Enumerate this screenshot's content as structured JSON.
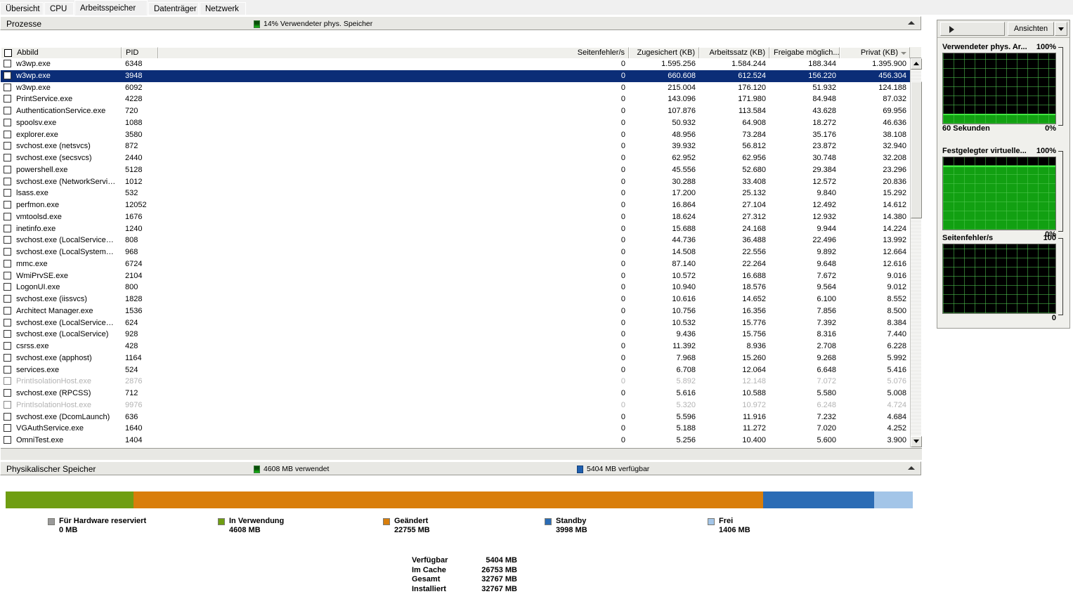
{
  "tabs": [
    {
      "label": "Übersicht",
      "selected": false
    },
    {
      "label": "CPU",
      "selected": false
    },
    {
      "label": "Arbeitsspeicher",
      "selected": true
    },
    {
      "label": "Datenträger",
      "selected": false
    },
    {
      "label": "Netzwerk",
      "selected": false
    }
  ],
  "processes_section": {
    "title": "Prozesse",
    "meter_label": "14% Verwendeter phys. Speicher",
    "meter_swatch_color": "#19c219",
    "collapse_icon": "triangle-up-icon"
  },
  "table": {
    "columns": [
      {
        "key": "image",
        "label": "Abbild",
        "align": "left"
      },
      {
        "key": "pid",
        "label": "PID",
        "align": "left"
      },
      {
        "key": "faults",
        "label": "Seitenfehler/s",
        "align": "right"
      },
      {
        "key": "commit",
        "label": "Zugesichert (KB)",
        "align": "right"
      },
      {
        "key": "working",
        "label": "Arbeitssatz (KB)",
        "align": "right"
      },
      {
        "key": "shareable",
        "label": "Freigabe möglich...",
        "align": "right"
      },
      {
        "key": "private",
        "label": "Privat (KB)",
        "align": "right",
        "sorted": true
      }
    ],
    "rows": [
      {
        "image": "w3wp.exe",
        "pid": "6348",
        "faults": "0",
        "commit": "1.595.256",
        "working": "1.584.244",
        "shareable": "188.344",
        "private": "1.395.900",
        "selected": false,
        "dim": false
      },
      {
        "image": "w3wp.exe",
        "pid": "3948",
        "faults": "0",
        "commit": "660.608",
        "working": "612.524",
        "shareable": "156.220",
        "private": "456.304",
        "selected": true,
        "dim": false
      },
      {
        "image": "w3wp.exe",
        "pid": "6092",
        "faults": "0",
        "commit": "215.004",
        "working": "176.120",
        "shareable": "51.932",
        "private": "124.188",
        "selected": false,
        "dim": false
      },
      {
        "image": "PrintService.exe",
        "pid": "4228",
        "faults": "0",
        "commit": "143.096",
        "working": "171.980",
        "shareable": "84.948",
        "private": "87.032",
        "selected": false,
        "dim": false
      },
      {
        "image": "AuthenticationService.exe",
        "pid": "720",
        "faults": "0",
        "commit": "107.876",
        "working": "113.584",
        "shareable": "43.628",
        "private": "69.956",
        "selected": false,
        "dim": false
      },
      {
        "image": "spoolsv.exe",
        "pid": "1088",
        "faults": "0",
        "commit": "50.932",
        "working": "64.908",
        "shareable": "18.272",
        "private": "46.636",
        "selected": false,
        "dim": false
      },
      {
        "image": "explorer.exe",
        "pid": "3580",
        "faults": "0",
        "commit": "48.956",
        "working": "73.284",
        "shareable": "35.176",
        "private": "38.108",
        "selected": false,
        "dim": false
      },
      {
        "image": "svchost.exe (netsvcs)",
        "pid": "872",
        "faults": "0",
        "commit": "39.932",
        "working": "56.812",
        "shareable": "23.872",
        "private": "32.940",
        "selected": false,
        "dim": false
      },
      {
        "image": "svchost.exe (secsvcs)",
        "pid": "2440",
        "faults": "0",
        "commit": "62.952",
        "working": "62.956",
        "shareable": "30.748",
        "private": "32.208",
        "selected": false,
        "dim": false
      },
      {
        "image": "powershell.exe",
        "pid": "5128",
        "faults": "0",
        "commit": "45.556",
        "working": "52.680",
        "shareable": "29.384",
        "private": "23.296",
        "selected": false,
        "dim": false
      },
      {
        "image": "svchost.exe (NetworkService)",
        "pid": "1012",
        "faults": "0",
        "commit": "30.288",
        "working": "33.408",
        "shareable": "12.572",
        "private": "20.836",
        "selected": false,
        "dim": false
      },
      {
        "image": "lsass.exe",
        "pid": "532",
        "faults": "0",
        "commit": "17.200",
        "working": "25.132",
        "shareable": "9.840",
        "private": "15.292",
        "selected": false,
        "dim": false
      },
      {
        "image": "perfmon.exe",
        "pid": "12052",
        "faults": "0",
        "commit": "16.864",
        "working": "27.104",
        "shareable": "12.492",
        "private": "14.612",
        "selected": false,
        "dim": false
      },
      {
        "image": "vmtoolsd.exe",
        "pid": "1676",
        "faults": "0",
        "commit": "18.624",
        "working": "27.312",
        "shareable": "12.932",
        "private": "14.380",
        "selected": false,
        "dim": false
      },
      {
        "image": "inetinfo.exe",
        "pid": "1240",
        "faults": "0",
        "commit": "15.688",
        "working": "24.168",
        "shareable": "9.944",
        "private": "14.224",
        "selected": false,
        "dim": false
      },
      {
        "image": "svchost.exe (LocalServiceNetwo...",
        "pid": "808",
        "faults": "0",
        "commit": "44.736",
        "working": "36.488",
        "shareable": "22.496",
        "private": "13.992",
        "selected": false,
        "dim": false
      },
      {
        "image": "svchost.exe (LocalSystemNetwo...",
        "pid": "968",
        "faults": "0",
        "commit": "14.508",
        "working": "22.556",
        "shareable": "9.892",
        "private": "12.664",
        "selected": false,
        "dim": false
      },
      {
        "image": "mmc.exe",
        "pid": "6724",
        "faults": "0",
        "commit": "87.140",
        "working": "22.264",
        "shareable": "9.648",
        "private": "12.616",
        "selected": false,
        "dim": false
      },
      {
        "image": "WmiPrvSE.exe",
        "pid": "2104",
        "faults": "0",
        "commit": "10.572",
        "working": "16.688",
        "shareable": "7.672",
        "private": "9.016",
        "selected": false,
        "dim": false
      },
      {
        "image": "LogonUI.exe",
        "pid": "800",
        "faults": "0",
        "commit": "10.940",
        "working": "18.576",
        "shareable": "9.564",
        "private": "9.012",
        "selected": false,
        "dim": false
      },
      {
        "image": "svchost.exe (iissvcs)",
        "pid": "1828",
        "faults": "0",
        "commit": "10.616",
        "working": "14.652",
        "shareable": "6.100",
        "private": "8.552",
        "selected": false,
        "dim": false
      },
      {
        "image": "Architect Manager.exe",
        "pid": "1536",
        "faults": "0",
        "commit": "10.756",
        "working": "16.356",
        "shareable": "7.856",
        "private": "8.500",
        "selected": false,
        "dim": false
      },
      {
        "image": "svchost.exe (LocalServiceNoNet...",
        "pid": "624",
        "faults": "0",
        "commit": "10.532",
        "working": "15.776",
        "shareable": "7.392",
        "private": "8.384",
        "selected": false,
        "dim": false
      },
      {
        "image": "svchost.exe (LocalService)",
        "pid": "928",
        "faults": "0",
        "commit": "9.436",
        "working": "15.756",
        "shareable": "8.316",
        "private": "7.440",
        "selected": false,
        "dim": false
      },
      {
        "image": "csrss.exe",
        "pid": "428",
        "faults": "0",
        "commit": "11.392",
        "working": "8.936",
        "shareable": "2.708",
        "private": "6.228",
        "selected": false,
        "dim": false
      },
      {
        "image": "svchost.exe (apphost)",
        "pid": "1164",
        "faults": "0",
        "commit": "7.968",
        "working": "15.260",
        "shareable": "9.268",
        "private": "5.992",
        "selected": false,
        "dim": false
      },
      {
        "image": "services.exe",
        "pid": "524",
        "faults": "0",
        "commit": "6.708",
        "working": "12.064",
        "shareable": "6.648",
        "private": "5.416",
        "selected": false,
        "dim": false
      },
      {
        "image": "PrintIsolationHost.exe",
        "pid": "2876",
        "faults": "0",
        "commit": "5.892",
        "working": "12.148",
        "shareable": "7.072",
        "private": "5.076",
        "selected": false,
        "dim": true
      },
      {
        "image": "svchost.exe (RPCSS)",
        "pid": "712",
        "faults": "0",
        "commit": "5.616",
        "working": "10.588",
        "shareable": "5.580",
        "private": "5.008",
        "selected": false,
        "dim": false
      },
      {
        "image": "PrintIsolationHost.exe",
        "pid": "9976",
        "faults": "0",
        "commit": "5.320",
        "working": "10.972",
        "shareable": "6.248",
        "private": "4.724",
        "selected": false,
        "dim": true
      },
      {
        "image": "svchost.exe (DcomLaunch)",
        "pid": "636",
        "faults": "0",
        "commit": "5.596",
        "working": "11.916",
        "shareable": "7.232",
        "private": "4.684",
        "selected": false,
        "dim": false
      },
      {
        "image": "VGAuthService.exe",
        "pid": "1640",
        "faults": "0",
        "commit": "5.188",
        "working": "11.272",
        "shareable": "7.020",
        "private": "4.252",
        "selected": false,
        "dim": false
      },
      {
        "image": "OmniTest.exe",
        "pid": "1404",
        "faults": "0",
        "commit": "5.256",
        "working": "10.400",
        "shareable": "5.600",
        "private": "3.900",
        "selected": false,
        "dim": false
      }
    ]
  },
  "physical_memory": {
    "title": "Physikalischer Speicher",
    "used_label": "4608 MB verwendet",
    "available_label": "5404 MB verfügbar",
    "collapse_icon": "triangle-up-icon",
    "segments": [
      {
        "name": "Für Hardware reserviert",
        "value": "0 MB",
        "mb": 0,
        "color": "#9a9a9a"
      },
      {
        "name": "In Verwendung",
        "value": "4608 MB",
        "mb": 4608,
        "color": "#6f9e12"
      },
      {
        "name": "Geändert",
        "value": "22755 MB",
        "mb": 22755,
        "color": "#d97e0b"
      },
      {
        "name": "Standby",
        "value": "3998 MB",
        "mb": 3998,
        "color": "#2b6cb5"
      },
      {
        "name": "Frei",
        "value": "1406 MB",
        "mb": 1406,
        "color": "#a3c5e8"
      }
    ],
    "summary": [
      {
        "key": "Verfügbar",
        "value": "5404 MB"
      },
      {
        "key": "Im Cache",
        "value": "26753 MB"
      },
      {
        "key": "Gesamt",
        "value": "32767 MB"
      },
      {
        "key": "Installiert",
        "value": "32767 MB"
      }
    ]
  },
  "right_panel": {
    "expander_icon": "triangle-right-icon",
    "views_label": "Ansichten",
    "views_arrow_icon": "chevron-down-icon",
    "graphs": [
      {
        "title": "Verwendeter phys. Ar...",
        "max_label": "100%",
        "footer_left": "60 Sekunden",
        "footer_right": "0%",
        "fill_percent": 14,
        "line_color": "#3ef03e",
        "fill_color": "#12a012"
      },
      {
        "title": "Festgelegter virtuelle...",
        "max_label": "100%",
        "footer_left": "",
        "footer_right": "0%",
        "fill_percent": 88,
        "line_color": "#3ef03e",
        "fill_color": "#12a012"
      },
      {
        "title": "Seitenfehler/s",
        "max_label": "100",
        "footer_left": "",
        "footer_right": "0",
        "fill_percent": 0,
        "line_color": "#3ef03e",
        "fill_color": "#12a012"
      }
    ]
  }
}
